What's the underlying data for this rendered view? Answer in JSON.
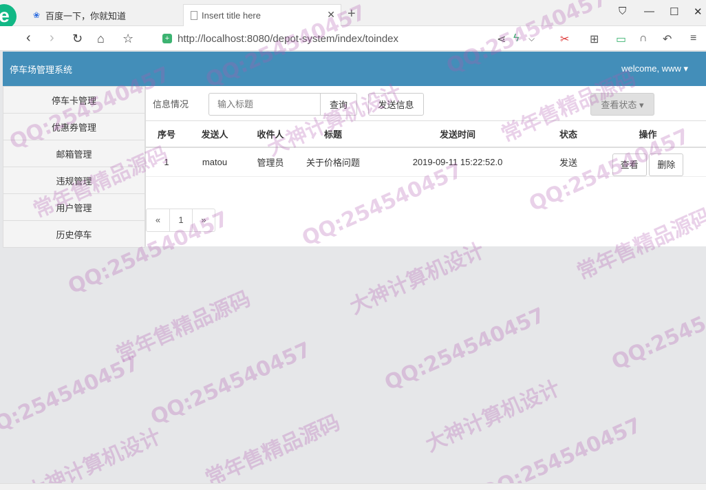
{
  "browser": {
    "tabs": [
      {
        "title": "百度一下，你就知道",
        "icon": "baidu-paw-icon"
      },
      {
        "title": "Insert title here",
        "icon": "document-icon"
      }
    ],
    "url": "http://localhost:8080/depot-system/index/toindex"
  },
  "app": {
    "title": "停车场管理系统",
    "user_menu": "welcome, www ▾"
  },
  "sidebar": {
    "items": [
      "停车卡管理",
      "优惠券管理",
      "邮箱管理",
      "违规管理",
      "用户管理",
      "历史停车"
    ]
  },
  "toolbar": {
    "label": "信息情况",
    "search_placeholder": "输入标题",
    "query_label": "查询",
    "send_label": "发送信息",
    "status_label": "查看状态 ▾"
  },
  "table": {
    "headers": [
      "序号",
      "发送人",
      "收件人",
      "标题",
      "发送时间",
      "状态",
      "操作"
    ],
    "rows": [
      {
        "id": "1",
        "sender": "matou",
        "recipient": "管理员",
        "title": "关于价格问题",
        "time": "2019-09-11 15:22:52.0",
        "status": "发送",
        "view_label": "查看",
        "delete_label": "删除"
      }
    ]
  },
  "pager": {
    "prev": "«",
    "page": "1",
    "next": "»"
  },
  "watermark": [
    "QQ:254540457",
    "常年售精品源码",
    "大神计算机设计"
  ],
  "colors": {
    "header_bg": "#438eb9",
    "watermark": "#af5aaf"
  }
}
